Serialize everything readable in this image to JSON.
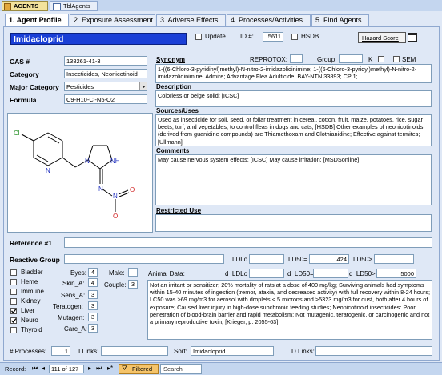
{
  "doc_tabs": [
    "AGENTS",
    "TblAgents"
  ],
  "tabs": [
    {
      "label": "1. Agent Profile"
    },
    {
      "label": "2. Exposure Assessment"
    },
    {
      "label": "3. Adverse Effects"
    },
    {
      "label": "4. Processes/Activities"
    },
    {
      "label": "5. Find Agents"
    }
  ],
  "header": {
    "agent_name": "Imidacloprid",
    "update_label": "Update",
    "id_label": "ID #:",
    "id_value": "5611",
    "hsdb_label": "HSDB",
    "hazard_button": "Hazard Score"
  },
  "profile": {
    "cas_label": "CAS #",
    "cas_value": "138261-41-3",
    "category_label": "Category",
    "category_value": "Insecticides, Neonicotinoid",
    "major_label": "Major Category",
    "major_value": "Pesticides",
    "formula_label": "Formula",
    "formula_value": "C9-H10-Cl-N5-O2"
  },
  "synonym": {
    "label": "Synonym",
    "reprotox_label": "REPROTOX:",
    "group_label": "Group:",
    "k_label": "K",
    "sem_label": "SEM",
    "text": "1-((6-Chloro-3-pyridinyl)methyl)-N-nitro-2-imidazolidinimine; 1-((6-Chloro-3-pyridyl)methyl)-N-nitro-2-imidazolidinimine; Admire; Advantage Flea Adulticide; BAY-NTN 33893; CP 1;"
  },
  "description": {
    "label": "Description",
    "text": "Colorless or beige solid; [ICSC]"
  },
  "sources": {
    "label": "Sources/Uses",
    "text": "Used as insecticide for soil, seed, or foliar treatment in cereal, cotton, fruit, maize, potatoes, rice, sugar beets, turf, and vegetables; to control fleas in dogs and cats; [HSDB] Other examples of neonicotinoids (derived from guanidine compounds) are Thiamethoxam and Clothianidine; Effective against termites; [Ullmann]"
  },
  "comments": {
    "label": "Comments",
    "text": "May cause nervous system effects; [ICSC] May cause irritation; [MSDSonline]"
  },
  "restricted": {
    "label": "Restricted Use",
    "text": ""
  },
  "structure": {
    "atoms": [
      "Cl",
      "N",
      "N",
      "NH",
      "N",
      "N",
      "O",
      "O"
    ]
  },
  "reference": {
    "label": "Reference #1",
    "value": ""
  },
  "reactive": {
    "label": "Reactive Group",
    "value": ""
  },
  "tox": {
    "ldlo_label": "LDLo",
    "ld50_label": "LD50=",
    "ld50_value": "424",
    "ld50gt_label": "LD50>",
    "animal_label": "Animal Data:",
    "d_ldlo_label": "d_LDLo",
    "d_ld50_label": "d_LD50=",
    "d_ld50gt_label": "d_LD50>",
    "d_ld50gt_value": "5000",
    "animal_text": "Not an irritant or sensitizer; 20% mortality of rats at a dose of 400 mg/kg; Surviving animals had symptoms within 15-40 minutes of ingestion (tremor, ataxia, and decreased activity) with full recovery within 8-24 hours; LC50 was >69 mg/m3 for aerosol with droplets < 5 microns and >5323 mg/m3 for dust, both after 4 hours of exposure; Caused liver injury in high-dose subchronic feeding studies; Neonicotinoid insecticides: Poor penetration of blood-brain barrier and rapid metabolism; Not mutagenic, teratogenic, or carcinogenic and not a primary reproductive toxin; [Krieger, p. 2055-63]"
  },
  "organs": [
    {
      "label": "Bladder",
      "checked": false
    },
    {
      "label": "Heme",
      "checked": false
    },
    {
      "label": "Immune",
      "checked": false
    },
    {
      "label": "Kidney",
      "checked": false
    },
    {
      "label": "Liver",
      "checked": true
    },
    {
      "label": "Neuro",
      "checked": true
    },
    {
      "label": "Thyroid",
      "checked": false
    }
  ],
  "scores": {
    "eyes_label": "Eyes:",
    "eyes": "4",
    "skin_label": "Skin_A:",
    "skin": "4",
    "sens_label": "Sens_A:",
    "sens": "3",
    "terat_label": "Teratogen:",
    "terat": "3",
    "mutag_label": "Mutagen:",
    "mutag": "3",
    "carc_label": "Carc_A:",
    "carc": "3",
    "male_label": "Male:",
    "male": "",
    "couple_label": "Couple:",
    "couple": "3"
  },
  "footer": {
    "processes_label": "# Processes:",
    "processes_value": "1",
    "ilinks_label": "I Links:",
    "ilinks_value": "",
    "sort_label": "Sort:",
    "sort_value": "Imidacloprid",
    "dlinks_label": "D Links:",
    "dlinks_value": ""
  },
  "nav": {
    "record_label": "Record:",
    "position": "111 of 127",
    "filter_label": "Filtered",
    "search_label": "Search"
  },
  "colors": {
    "name_bg": "#1a3fd6",
    "form_bg": "#dfe8f6",
    "tab_active": "#ffffff",
    "nav_bg": "#c4d6ef",
    "filter_bg": "#f5c46a"
  }
}
